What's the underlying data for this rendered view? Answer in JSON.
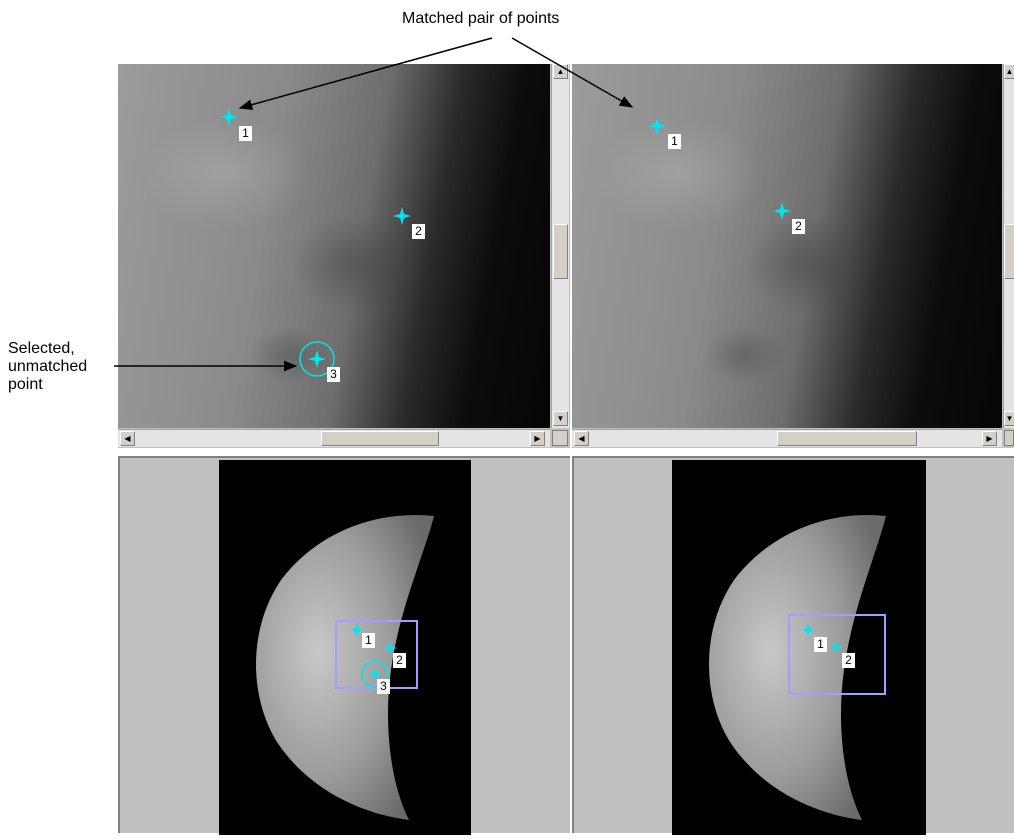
{
  "annotations": {
    "matched_pair": "Matched pair of points",
    "selected_line1": "Selected,",
    "selected_line2": "unmatched",
    "selected_line3": "point"
  },
  "colors": {
    "point_marker": "#00e5ee",
    "detail_rect": "#9da0ff",
    "panel_bg": "#c0c0c0"
  },
  "icons": {
    "scroll_up": "▲",
    "scroll_down": "▼",
    "scroll_left": "◀",
    "scroll_right": "▶"
  },
  "input_view": {
    "points": [
      {
        "label": "1"
      },
      {
        "label": "2"
      },
      {
        "label": "3",
        "selected": true
      }
    ]
  },
  "base_view": {
    "points": [
      {
        "label": "1"
      },
      {
        "label": "2"
      }
    ]
  }
}
